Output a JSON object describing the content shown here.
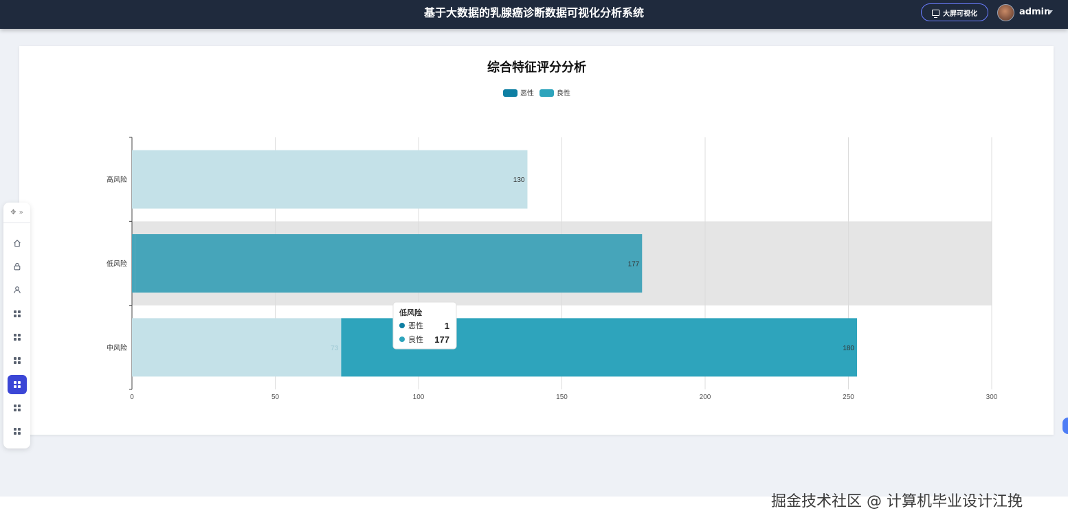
{
  "header": {
    "title": "基于大数据的乳腺癌诊断数据可视化分析系统",
    "bigscreen_label": "大屏可视化",
    "user": "admin"
  },
  "sidebar": {
    "items": [
      {
        "icon": "home-icon"
      },
      {
        "icon": "lock-icon"
      },
      {
        "icon": "user-icon"
      },
      {
        "icon": "grid-icon"
      },
      {
        "icon": "grid-icon"
      },
      {
        "icon": "grid-icon"
      },
      {
        "icon": "grid-icon",
        "active": true
      },
      {
        "icon": "grid-icon"
      },
      {
        "icon": "grid-icon"
      }
    ]
  },
  "chart_data": {
    "type": "bar",
    "orientation": "horizontal",
    "stacked": true,
    "title": "综合特征评分分析",
    "categories": [
      "高风险",
      "低风险",
      "中风险"
    ],
    "series": [
      {
        "name": "恶性",
        "color": "#0e7fa3",
        "values": [
          138,
          1,
          73
        ]
      },
      {
        "name": "良性",
        "color": "#2ea4bc",
        "values": [
          0,
          177,
          180
        ]
      }
    ],
    "data_labels": [
      {
        "category": "高风险",
        "text": "130"
      },
      {
        "category": "低风险",
        "text": "177"
      },
      {
        "category": "中风险",
        "left_text": "73",
        "text": "180"
      }
    ],
    "xlim": [
      0,
      300
    ],
    "xticks": [
      0,
      50,
      100,
      150,
      200,
      250,
      300
    ],
    "grid": true,
    "legend": "top-center",
    "highlighted_category": "低风险",
    "tooltip": {
      "title": "低风险",
      "rows": [
        {
          "name": "恶性",
          "value": "1"
        },
        {
          "name": "良性",
          "value": "177"
        }
      ]
    }
  },
  "watermark": "掘金技术社区 @ 计算机毕业设计江挽"
}
